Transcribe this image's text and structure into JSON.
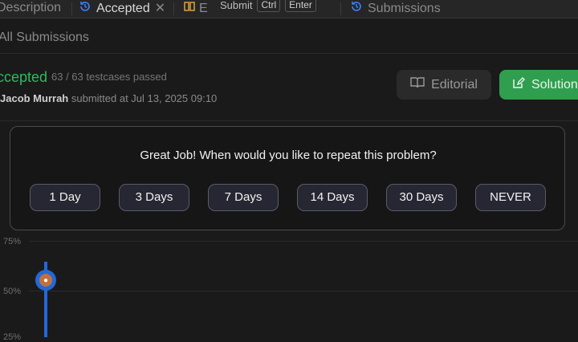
{
  "tabs": {
    "description": "Description",
    "accepted": "Accepted",
    "editorial_partial": "E",
    "submissions": "Submissions"
  },
  "shortcut": {
    "submit": "Submit",
    "key1": "Ctrl",
    "key2": "Enter"
  },
  "breadcrumb": "All Submissions",
  "result": {
    "status": "ccepted",
    "passed": "63 / 63 testcases passed",
    "user": "Jacob Murrah",
    "submitted_text": "submitted at Jul 13, 2025 09:10"
  },
  "buttons": {
    "editorial": "Editorial",
    "solution": "Solution"
  },
  "chart": {
    "y_labels": [
      "75%",
      "50%",
      "25%"
    ]
  },
  "modal": {
    "question": "Great Job! When would you like to repeat this problem?",
    "options": [
      "1 Day",
      "3 Days",
      "7 Days",
      "14 Days",
      "30 Days",
      "NEVER"
    ]
  },
  "colors": {
    "accent_green": "#2cbb5d",
    "accent_blue": "#2468d8"
  }
}
